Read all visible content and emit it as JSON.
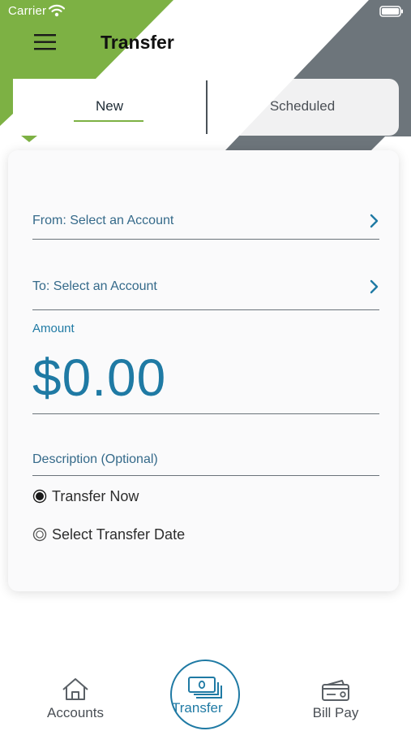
{
  "status_bar": {
    "carrier": "Carrier"
  },
  "header": {
    "title": "Transfer"
  },
  "tabs": [
    {
      "label": "New",
      "selected": true
    },
    {
      "label": "Scheduled",
      "selected": false
    }
  ],
  "form": {
    "from_label": "From: Select an Account",
    "to_label": "To: Select an Account",
    "amount_label": "Amount",
    "amount_value": "$0.00",
    "description_placeholder": "Description (Optional)",
    "radio_options": [
      {
        "label": "Transfer Now",
        "checked": true
      },
      {
        "label": "Select Transfer Date",
        "checked": false
      }
    ]
  },
  "bottom_nav": [
    {
      "label": "Accounts",
      "icon": "home-icon",
      "active": false
    },
    {
      "label": "Transfer",
      "icon": "money-icon",
      "active": true
    },
    {
      "label": "Bill Pay",
      "icon": "wallet-icon",
      "active": false
    }
  ],
  "colors": {
    "brand_green": "#7db144",
    "brand_slate": "#6d757b",
    "accent_blue": "#1f7aa4"
  }
}
